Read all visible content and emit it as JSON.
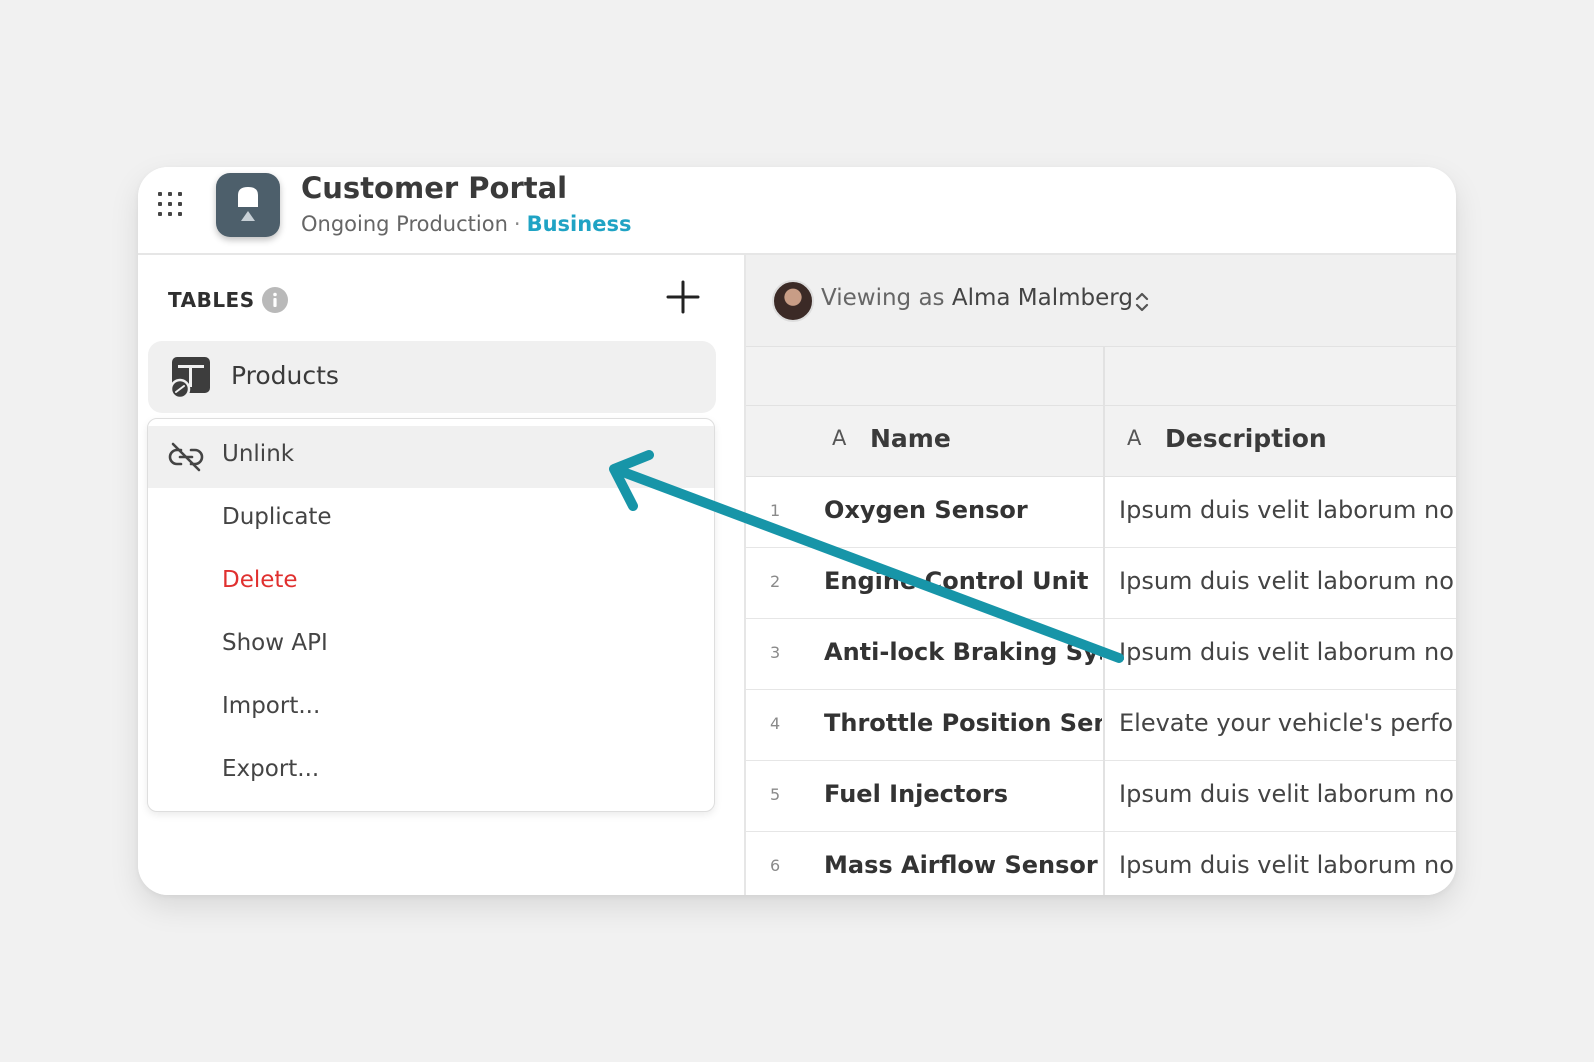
{
  "app": {
    "title": "Customer Portal",
    "subtitle": "Ongoing Production",
    "separator": "·",
    "plan": "Business",
    "icon": "app-bell-icon"
  },
  "sidebar": {
    "section_label": "TABLES",
    "selected_table": "Products",
    "menu": {
      "items": [
        {
          "label": "Unlink",
          "icon": "unlink-icon",
          "active": true
        },
        {
          "label": "Duplicate"
        },
        {
          "label": "Delete",
          "color": "#e0302f"
        },
        {
          "label": "Show API"
        },
        {
          "label": "Import..."
        },
        {
          "label": "Export..."
        }
      ]
    }
  },
  "viewbar": {
    "prefix": "Viewing as",
    "user": "Alma Malmberg"
  },
  "table": {
    "columns": [
      {
        "glyph": "A",
        "title": "Name"
      },
      {
        "glyph": "A",
        "title": "Description"
      }
    ],
    "rows": [
      {
        "num": "1",
        "name": "Oxygen Sensor",
        "desc": "Ipsum duis velit laborum no"
      },
      {
        "num": "2",
        "name": "Engine Control Unit",
        "desc": "Ipsum duis velit laborum no"
      },
      {
        "num": "3",
        "name": "Anti-lock Braking System",
        "desc": "Ipsum duis velit laborum no"
      },
      {
        "num": "4",
        "name": "Throttle Position Sensor",
        "desc": "Elevate your vehicle's perfo"
      },
      {
        "num": "5",
        "name": "Fuel Injectors",
        "desc": "Ipsum duis velit laborum no"
      },
      {
        "num": "6",
        "name": "Mass Airflow Sensor",
        "desc": "Ipsum duis velit laborum no"
      }
    ]
  },
  "colors": {
    "accent": "#1fa3c4",
    "arrow": "#1795a8",
    "danger": "#e0302f",
    "app_icon_bg": "#4d5f6b"
  }
}
